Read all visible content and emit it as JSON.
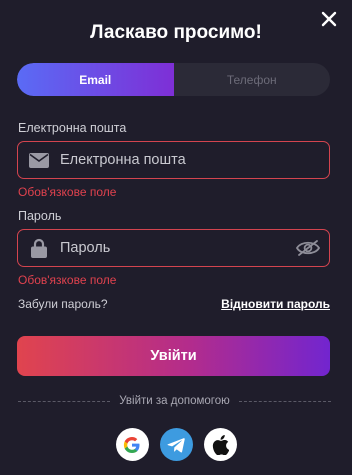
{
  "modal": {
    "title": "Ласкаво просимо!"
  },
  "tabs": [
    {
      "label": "Email",
      "active": true
    },
    {
      "label": "Телефон",
      "active": false
    }
  ],
  "email": {
    "label": "Електронна пошта",
    "placeholder": "Електронна пошта",
    "value": "",
    "error": "Обов'язкове поле",
    "icon": "envelope-icon"
  },
  "password": {
    "label": "Пароль",
    "placeholder": "Пароль",
    "value": "",
    "error": "Обов'язкове поле",
    "icon": "lock-icon",
    "toggle_icon": "eye-slash-icon"
  },
  "forgot": {
    "question": "Забули пароль?",
    "link": "Відновити пароль"
  },
  "login_button": "Увійти",
  "divider_text": "Увійти за допомогою",
  "socials": [
    "google-icon",
    "telegram-icon",
    "apple-icon"
  ],
  "colors": {
    "background": "#1f1d2b",
    "error": "#e0424e",
    "tab_gradient": [
      "#5a6bf5",
      "#7e2fd6"
    ],
    "button_gradient": [
      "#e0444e",
      "#7225cf"
    ]
  }
}
